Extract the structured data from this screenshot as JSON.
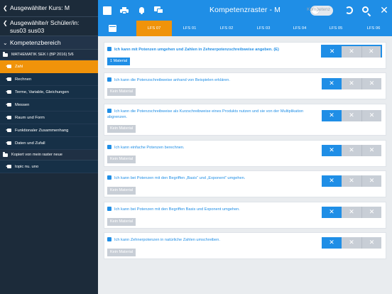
{
  "sidebar": {
    "course_label": "Ausgewählter Kurs: M",
    "student_label": "Ausgewählte/r Schüler/in: sus03 sus03",
    "competence_label": "Kompetenzbereich",
    "category": "MATHEMATIK SEK I (BP 2016) 5/6",
    "items": [
      {
        "label": "Zahl",
        "active": true
      },
      {
        "label": "Rechnen"
      },
      {
        "label": "Terme, Variable, Gleichungen"
      },
      {
        "label": "Messen"
      },
      {
        "label": "Raum und Form"
      },
      {
        "label": "Funktionaler Zusammenhang"
      },
      {
        "label": "Daten und Zufall"
      }
    ],
    "folder_label": "Kopiert von mein raster neue",
    "extra_item": "topic nu. uno"
  },
  "header": {
    "title": "Kompetenzraster - M",
    "toggle_label": "Kompetenz",
    "icons": [
      "square-icon",
      "printer-icon",
      "bell-icon",
      "chat-icon",
      "refresh-icon",
      "search-icon",
      "close-icon"
    ]
  },
  "tabs": [
    {
      "label": "LFS 07",
      "active": true
    },
    {
      "label": "LFS 01"
    },
    {
      "label": "LFS 02"
    },
    {
      "label": "LFS 03"
    },
    {
      "label": "LFS 04"
    },
    {
      "label": "LFS 05"
    },
    {
      "label": "LFS 06"
    }
  ],
  "cards": [
    {
      "text": "Ich kann mit Potenzen umgehen und Zahlen in Zehnerpotenzschreibweise angeben. (E)",
      "material": "1 Material",
      "bold": true,
      "has_material": true
    },
    {
      "text": "Ich kann die Potenzschreibweise anhand von Beispielen erklären.",
      "material": "Kein Material"
    },
    {
      "text": "Ich kann die Potenzschreibweise als Kurzschreibweise eines Produkts nutzen und sie von der Multiplikation abgrenzen.",
      "material": "Kein Material"
    },
    {
      "text": "Ich kann einfache Potenzen berechnen.",
      "material": "Kein Material"
    },
    {
      "text": "Ich kann bei Potenzen mit den Begriffen „Basis“ und „Exponent“ umgehen.",
      "material": "Kein Material"
    },
    {
      "text": "Ich kann bei Potenzen mit den Begriffen Basis und Exponent umgehen.",
      "material": "Kein Material"
    },
    {
      "text": "Ich kann Zehnerpotenzen in natürliche Zahlen umschreiben.",
      "material": "Kein Material"
    }
  ],
  "colors": {
    "accent": "#1f8ee6",
    "active_tab": "#f0930a",
    "sidebar_bg": "#1c2b3a"
  }
}
